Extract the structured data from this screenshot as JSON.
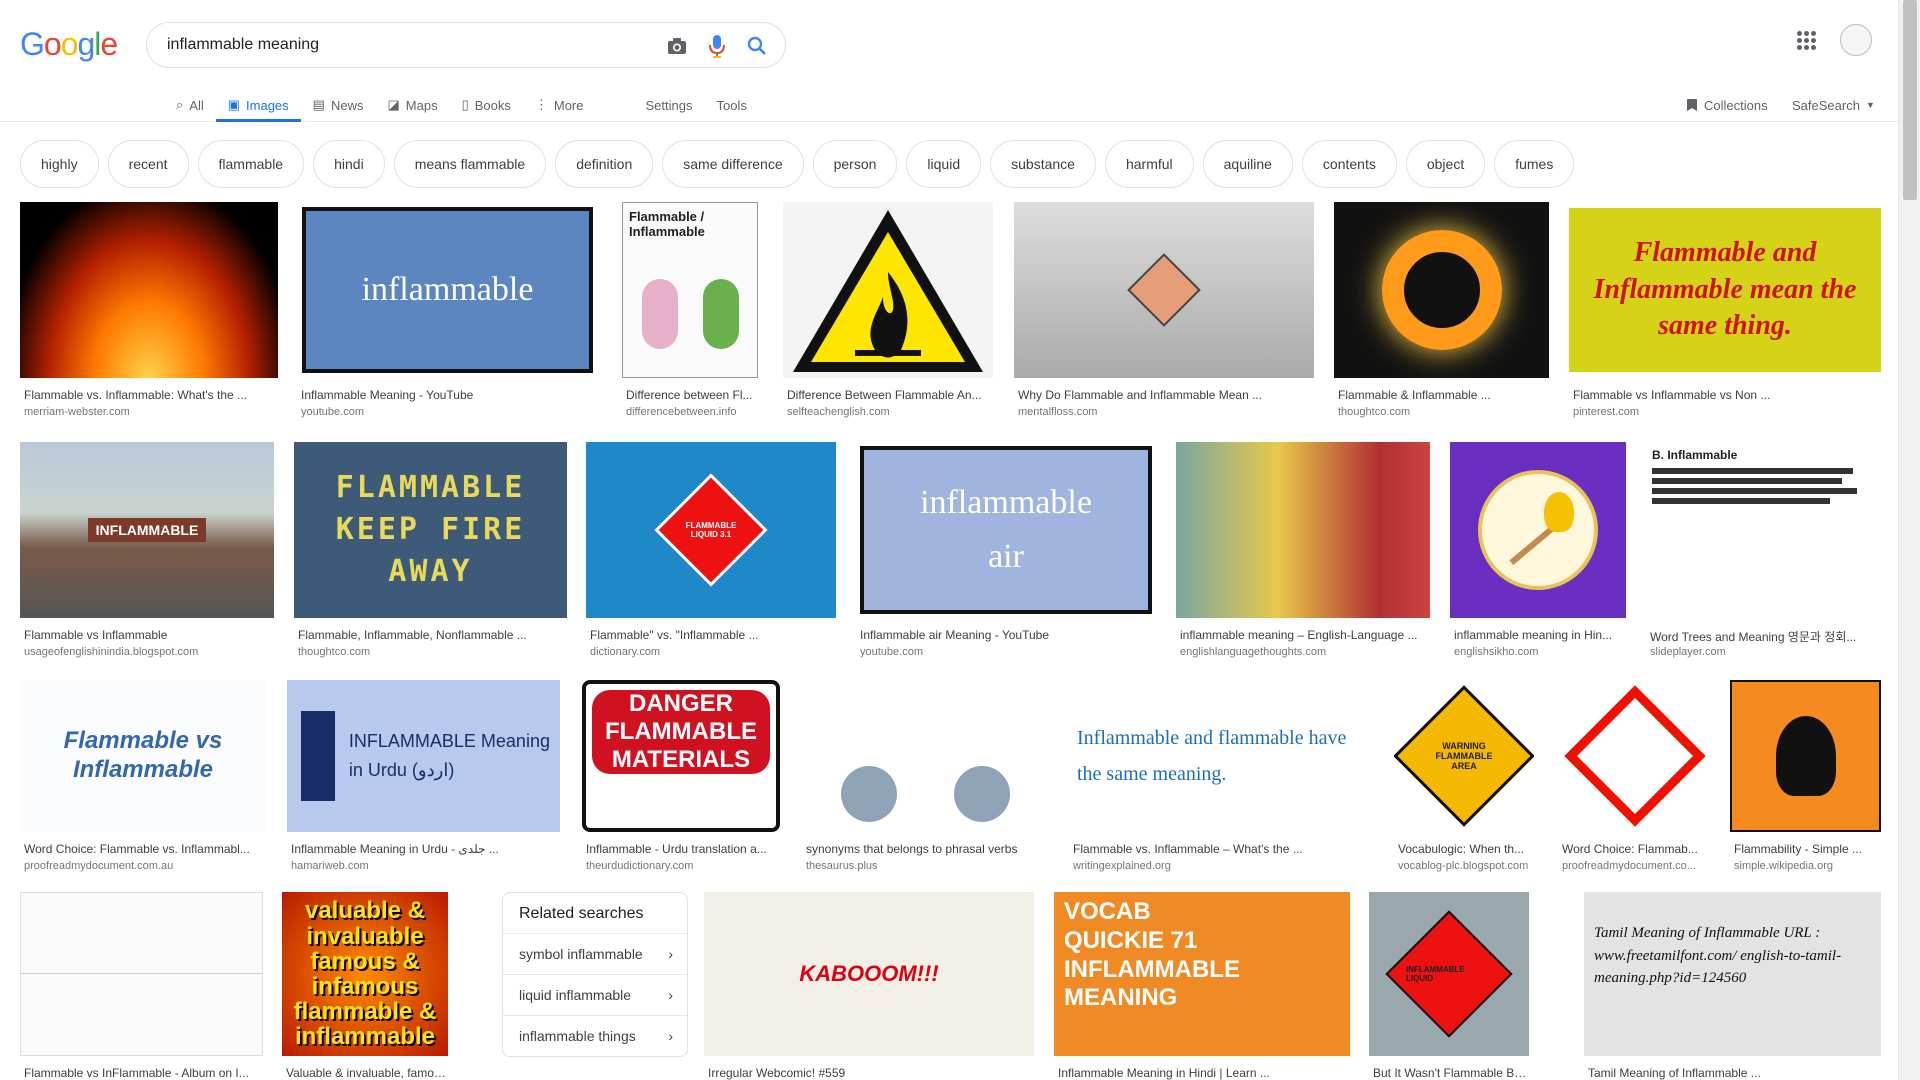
{
  "logo": {
    "letters": [
      "G",
      "o",
      "o",
      "g",
      "l",
      "e"
    ],
    "colors": [
      "#4285f4",
      "#ea4335",
      "#fbbc05",
      "#4285f4",
      "#34a853",
      "#ea4335"
    ]
  },
  "search": {
    "query": "inflammable meaning"
  },
  "icons": {
    "camera": "camera-icon",
    "mic": "mic-icon",
    "search": "search-icon",
    "apps": "apps-icon"
  },
  "tabs": [
    {
      "label": "All",
      "icon": "⌕"
    },
    {
      "label": "Images",
      "icon": "▣"
    },
    {
      "label": "News",
      "icon": "▤"
    },
    {
      "label": "Maps",
      "icon": "◪"
    },
    {
      "label": "Books",
      "icon": "▯"
    },
    {
      "label": "More",
      "icon": "⋮"
    }
  ],
  "tools": {
    "settings": "Settings",
    "tools": "Tools"
  },
  "right_tools": {
    "collections": "Collections",
    "safesearch": "SafeSearch"
  },
  "chips": [
    "highly",
    "recent",
    "flammable",
    "hindi",
    "means flammable",
    "definition",
    "same difference",
    "person",
    "liquid",
    "substance",
    "harmful",
    "aquiline",
    "contents",
    "object",
    "fumes"
  ],
  "results": [
    {
      "title": "Flammable vs. Inflammable: What's the ...",
      "source": "merriam-webster.com",
      "img": "fire"
    },
    {
      "title": "Inflammable Meaning - YouTube",
      "source": "youtube.com",
      "img": "inflammable",
      "img_text": "inflammable"
    },
    {
      "title": "Difference between Fl...",
      "source": "differencebetween.info",
      "img": "comic",
      "img_text": "Flammable / Inflammable"
    },
    {
      "title": "Difference Between Flammable An...",
      "source": "selfteachenglish.com",
      "img": "warn"
    },
    {
      "title": "Why Do Flammable and Inflammable Mean ...",
      "source": "mentalfloss.com",
      "img": "truck"
    },
    {
      "title": "Flammable & Inflammable ...",
      "source": "thoughtco.com",
      "img": "ring"
    },
    {
      "title": "Flammable vs Inflammable vs Non ...",
      "source": "pinterest.com",
      "img": "same",
      "img_text": "Flammable and Inflammable mean the same thing."
    },
    {
      "title": "Flammable vs Inflammable",
      "source": "usageofenglishinindia.blogspot.com",
      "img": "tanker",
      "img_text": "INFLAMMABLE"
    },
    {
      "title": "Flammable, Inflammable, Nonflammable ...",
      "source": "thoughtco.com",
      "img": "door",
      "img_text": "FLAMMABLE KEEP FIRE AWAY"
    },
    {
      "title": "Flammable\" vs. \"Inflammable ...",
      "source": "dictionary.com",
      "img": "liquid",
      "img_text": "FLAMMABLE LIQUID 3.1"
    },
    {
      "title": "Inflammable air Meaning - YouTube",
      "source": "youtube.com",
      "img": "air",
      "img_text": "inflammable air"
    },
    {
      "title": "inflammable meaning – English-Language ...",
      "source": "englishlanguagethoughts.com",
      "img": "simpsons"
    },
    {
      "title": "inflammable meaning in Hin...",
      "source": "englishsikho.com",
      "img": "match"
    },
    {
      "title": "Word Trees and Meaning 영문과 정회...",
      "source": "slideplayer.com",
      "img": "slide",
      "img_text": "B. Inflammable"
    },
    {
      "title": "Word Choice: Flammable vs. Inflammabl...",
      "source": "proofreadmydocument.com.au",
      "img": "proof",
      "img_text": "Flammable vs Inflammable"
    },
    {
      "title": "Inflammable Meaning in Urdu - جلدی ...",
      "source": "hamariweb.com",
      "img": "urdu",
      "img_text": "INFLAMMABLE Meaning in Urdu (اردو)"
    },
    {
      "title": "Inflammable - Urdu translation a...",
      "source": "theurdudictionary.com",
      "img": "danger",
      "img_text": "DANGER FLAMMABLE MATERIALS"
    },
    {
      "title": "synonyms that belongs to phrasal verbs",
      "source": "thesaurus.plus",
      "img": "pigeons"
    },
    {
      "title": "Flammable vs. Inflammable – What's the ...",
      "source": "writingexplained.org",
      "img": "quote",
      "img_text": "Inflammable and flammable have the same meaning."
    },
    {
      "title": "Vocabulogic: When th...",
      "source": "vocablog-plc.blogspot.com",
      "img": "diamond",
      "img_text": "WARNING FLAMMABLE AREA"
    },
    {
      "title": "Word Choice: Flammab...",
      "source": "proofreadmydocument.co...",
      "img": "ghs"
    },
    {
      "title": "Flammability - Simple ...",
      "source": "simple.wikipedia.org",
      "img": "orange"
    },
    {
      "title": "Flammable vs InFlammable - Album on I...",
      "source": "",
      "img": "graph"
    },
    {
      "title": "Valuable & invaluable, famous ...",
      "source": "",
      "img": "valuable",
      "img_text": "valuable & invaluable famous & infamous flammable & inflammable"
    },
    {
      "title": "Irregular Webcomic! #559",
      "source": "",
      "img": "lego",
      "img_text": "KABOOOM!!!"
    },
    {
      "title": "Inflammable Meaning in Hindi | Learn ...",
      "source": "",
      "img": "vocab",
      "img_text": "VOCAB QUICKIE 71 INFLAMMABLE MEANING"
    },
    {
      "title": "But It Wasn't Flammable Befor...",
      "source": "",
      "img": "redsign",
      "img_text": "INFLAMMABLE LIQUID"
    },
    {
      "title": "Tamil Meaning of Inflammable ...",
      "source": "",
      "img": "tamil",
      "img_text": "Tamil Meaning of Inflammable  URL : www.freetamilfont.com/ english-to-tamil-meaning.php?id=124560"
    }
  ],
  "related": {
    "title": "Related searches",
    "items": [
      "symbol inflammable",
      "liquid inflammable",
      "inflammable things"
    ]
  }
}
